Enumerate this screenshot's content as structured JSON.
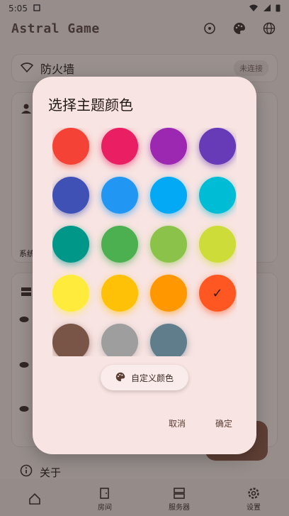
{
  "status_bar": {
    "time": "5:05"
  },
  "app_bar": {
    "title": "Astral Game",
    "actions": [
      "sync-icon",
      "palette-icon",
      "globe-icon"
    ]
  },
  "firewall_card": {
    "label": "防火墙",
    "status": "未连接"
  },
  "user_card": {
    "partial_label": "系统"
  },
  "about": {
    "label": "关于"
  },
  "bottom_nav": {
    "items": [
      {
        "label": "房间"
      },
      {
        "label": "服务器"
      },
      {
        "label": "设置"
      }
    ]
  },
  "dialog": {
    "title": "选择主题颜色",
    "colors": [
      "#f44336",
      "#e91e63",
      "#9c27b0",
      "#673ab7",
      "#3f51b5",
      "#2196f3",
      "#03a9f4",
      "#00bcd4",
      "#009688",
      "#4caf50",
      "#8bc34a",
      "#cddc39",
      "#ffeb3b",
      "#ffc107",
      "#ff9800",
      "#ff5722",
      "#795548",
      "#9e9e9e",
      "#607d8b"
    ],
    "selected_index": 15,
    "check_mark": "✓",
    "custom_color_label": "自定义颜色",
    "cancel_label": "取消",
    "confirm_label": "确定"
  }
}
